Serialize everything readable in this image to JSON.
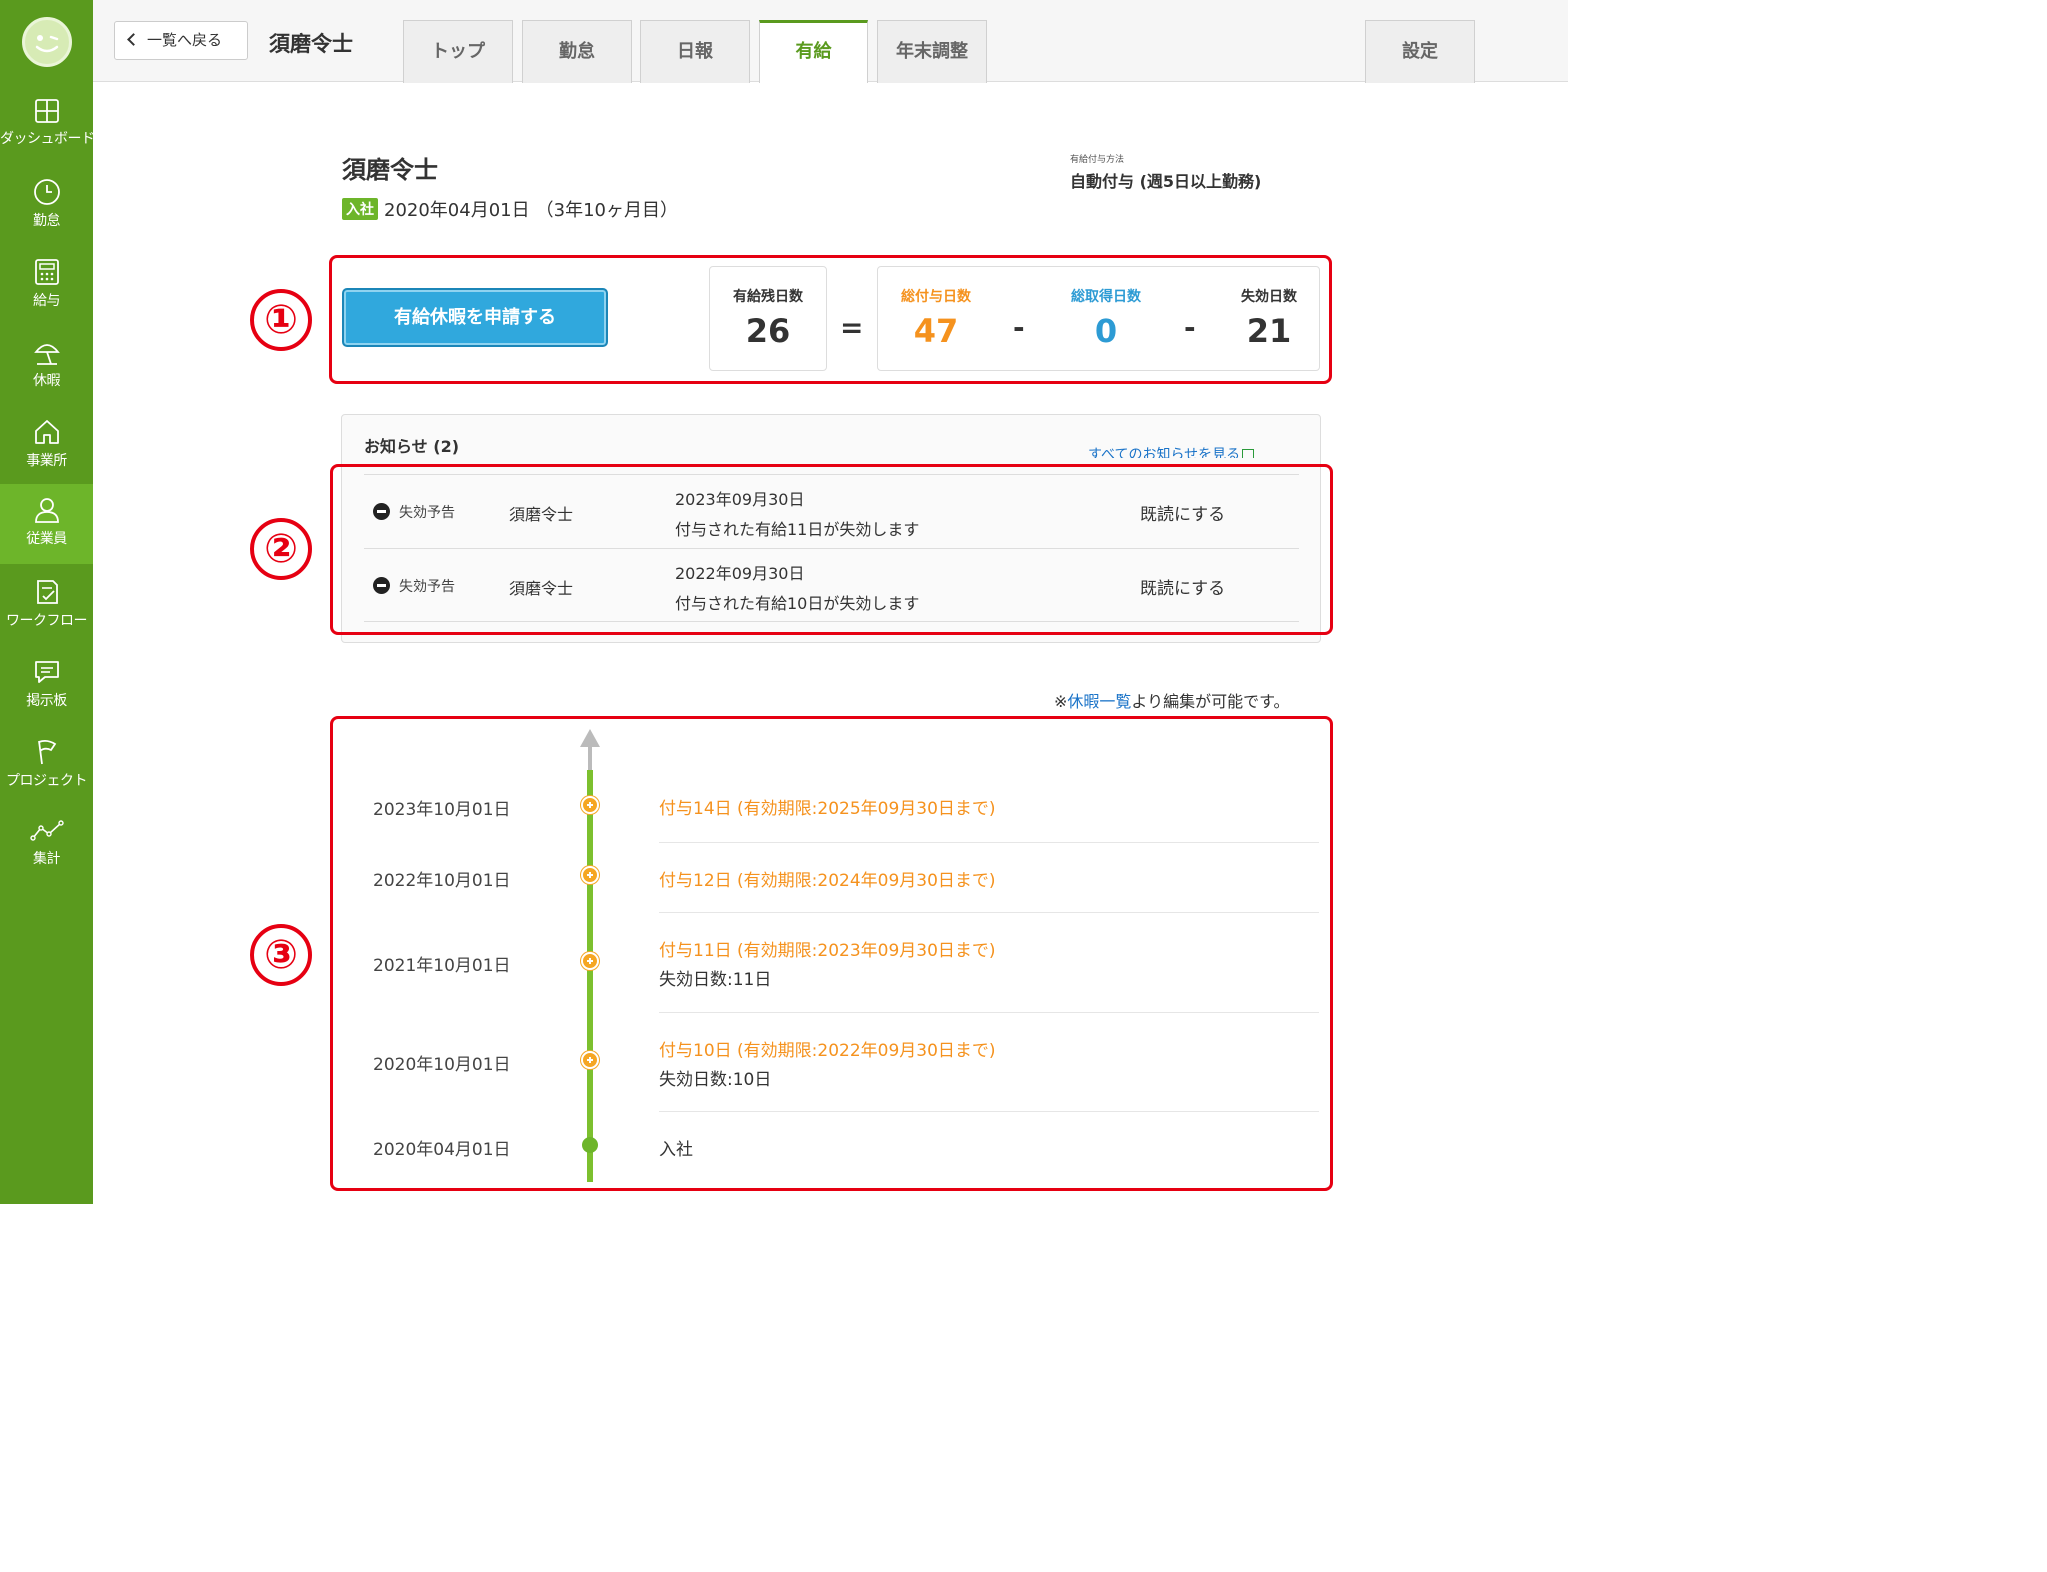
{
  "sidebar": {
    "items": [
      {
        "label": "ダッシュボード",
        "icon": "dashboard-icon"
      },
      {
        "label": "勤怠",
        "icon": "clock-icon"
      },
      {
        "label": "給与",
        "icon": "calculator-icon"
      },
      {
        "label": "休暇",
        "icon": "beach-umbrella-icon"
      },
      {
        "label": "事業所",
        "icon": "home-icon"
      },
      {
        "label": "従業員",
        "icon": "person-icon"
      },
      {
        "label": "ワークフロー",
        "icon": "checklist-icon"
      },
      {
        "label": "掲示板",
        "icon": "speech-bubble-icon"
      },
      {
        "label": "プロジェクト",
        "icon": "flag-icon"
      },
      {
        "label": "集計",
        "icon": "line-graph-icon"
      }
    ],
    "active_index": 5
  },
  "header": {
    "back_label": "一覧へ戻る",
    "employee_name": "須磨令士",
    "tabs": [
      "トップ",
      "勤怠",
      "日報",
      "有給",
      "年末調整"
    ],
    "active_tab": "有給",
    "settings_label": "設定"
  },
  "employee": {
    "name": "須磨令士",
    "join_badge": "入社",
    "join_date": "2020年04月01日",
    "tenure": "（3年10ヶ月目）",
    "grant_method_label": "有給付与方法",
    "grant_method_value": "自動付与 (週5日以上勤務)"
  },
  "annotations": [
    "①",
    "②",
    "③"
  ],
  "summary": {
    "apply_button": "有給休暇を申請する",
    "remaining_label": "有給残日数",
    "remaining_value": "26",
    "equals": "=",
    "minus": "-",
    "granted_label": "総付与日数",
    "granted_value": "47",
    "taken_label": "総取得日数",
    "taken_value": "0",
    "expired_label": "失効日数",
    "expired_value": "21",
    "colors": {
      "granted": "#f5921e",
      "taken": "#2d9bd4"
    }
  },
  "notices": {
    "title": "お知らせ (2)",
    "view_all": "すべてのお知らせを見る",
    "items": [
      {
        "type": "失効予告",
        "name": "須磨令士",
        "date": "2023年09月30日",
        "message": "付与された有給11日が失効します",
        "action": "既読にする"
      },
      {
        "type": "失効予告",
        "name": "須磨令士",
        "date": "2022年09月30日",
        "message": "付与された有給10日が失効します",
        "action": "既読にする"
      }
    ]
  },
  "edit_note": {
    "prefix": "※",
    "link": "休暇一覧",
    "suffix": "より編集が可能です。"
  },
  "timeline": [
    {
      "date": "2023年10月01日",
      "grant": "付与14日 (有効期限:2025年09月30日まで)",
      "expire": ""
    },
    {
      "date": "2022年10月01日",
      "grant": "付与12日 (有効期限:2024年09月30日まで)",
      "expire": ""
    },
    {
      "date": "2021年10月01日",
      "grant": "付与11日 (有効期限:2023年09月30日まで)",
      "expire": "失効日数:11日"
    },
    {
      "date": "2020年10月01日",
      "grant": "付与10日 (有効期限:2022年09月30日まで)",
      "expire": "失効日数:10日"
    },
    {
      "date": "2020年04月01日",
      "grant": "",
      "expire": "入社"
    }
  ]
}
